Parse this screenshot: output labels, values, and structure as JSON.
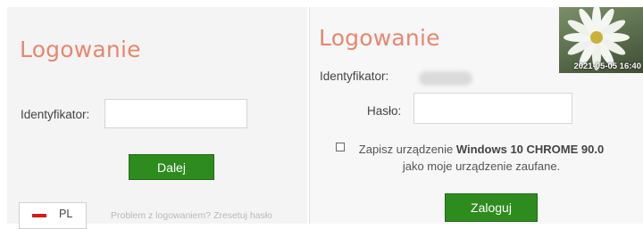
{
  "left": {
    "title": "Logowanie",
    "identifier_label": "Identyfikator:",
    "identifier_value": "",
    "next_button": "Dalej",
    "language_code": "PL",
    "problem_link": "Problem z logowaniem? Zresetuj hasło"
  },
  "right": {
    "title": "Logowanie",
    "identifier_label": "Identyfikator:",
    "password_label": "Hasło:",
    "password_value": "",
    "remember_prefix": "Zapisz urządzenie ",
    "remember_device": "Windows 10 CHROME 90.0",
    "remember_suffix": "jako moje urządzenie zaufane.",
    "login_button": "Zaloguj",
    "photo_timestamp": "2021-05-05 16:40"
  },
  "colors": {
    "accent_title": "#e8876e",
    "button_green": "#2e8b1e",
    "flag_red": "#d41a1a"
  }
}
